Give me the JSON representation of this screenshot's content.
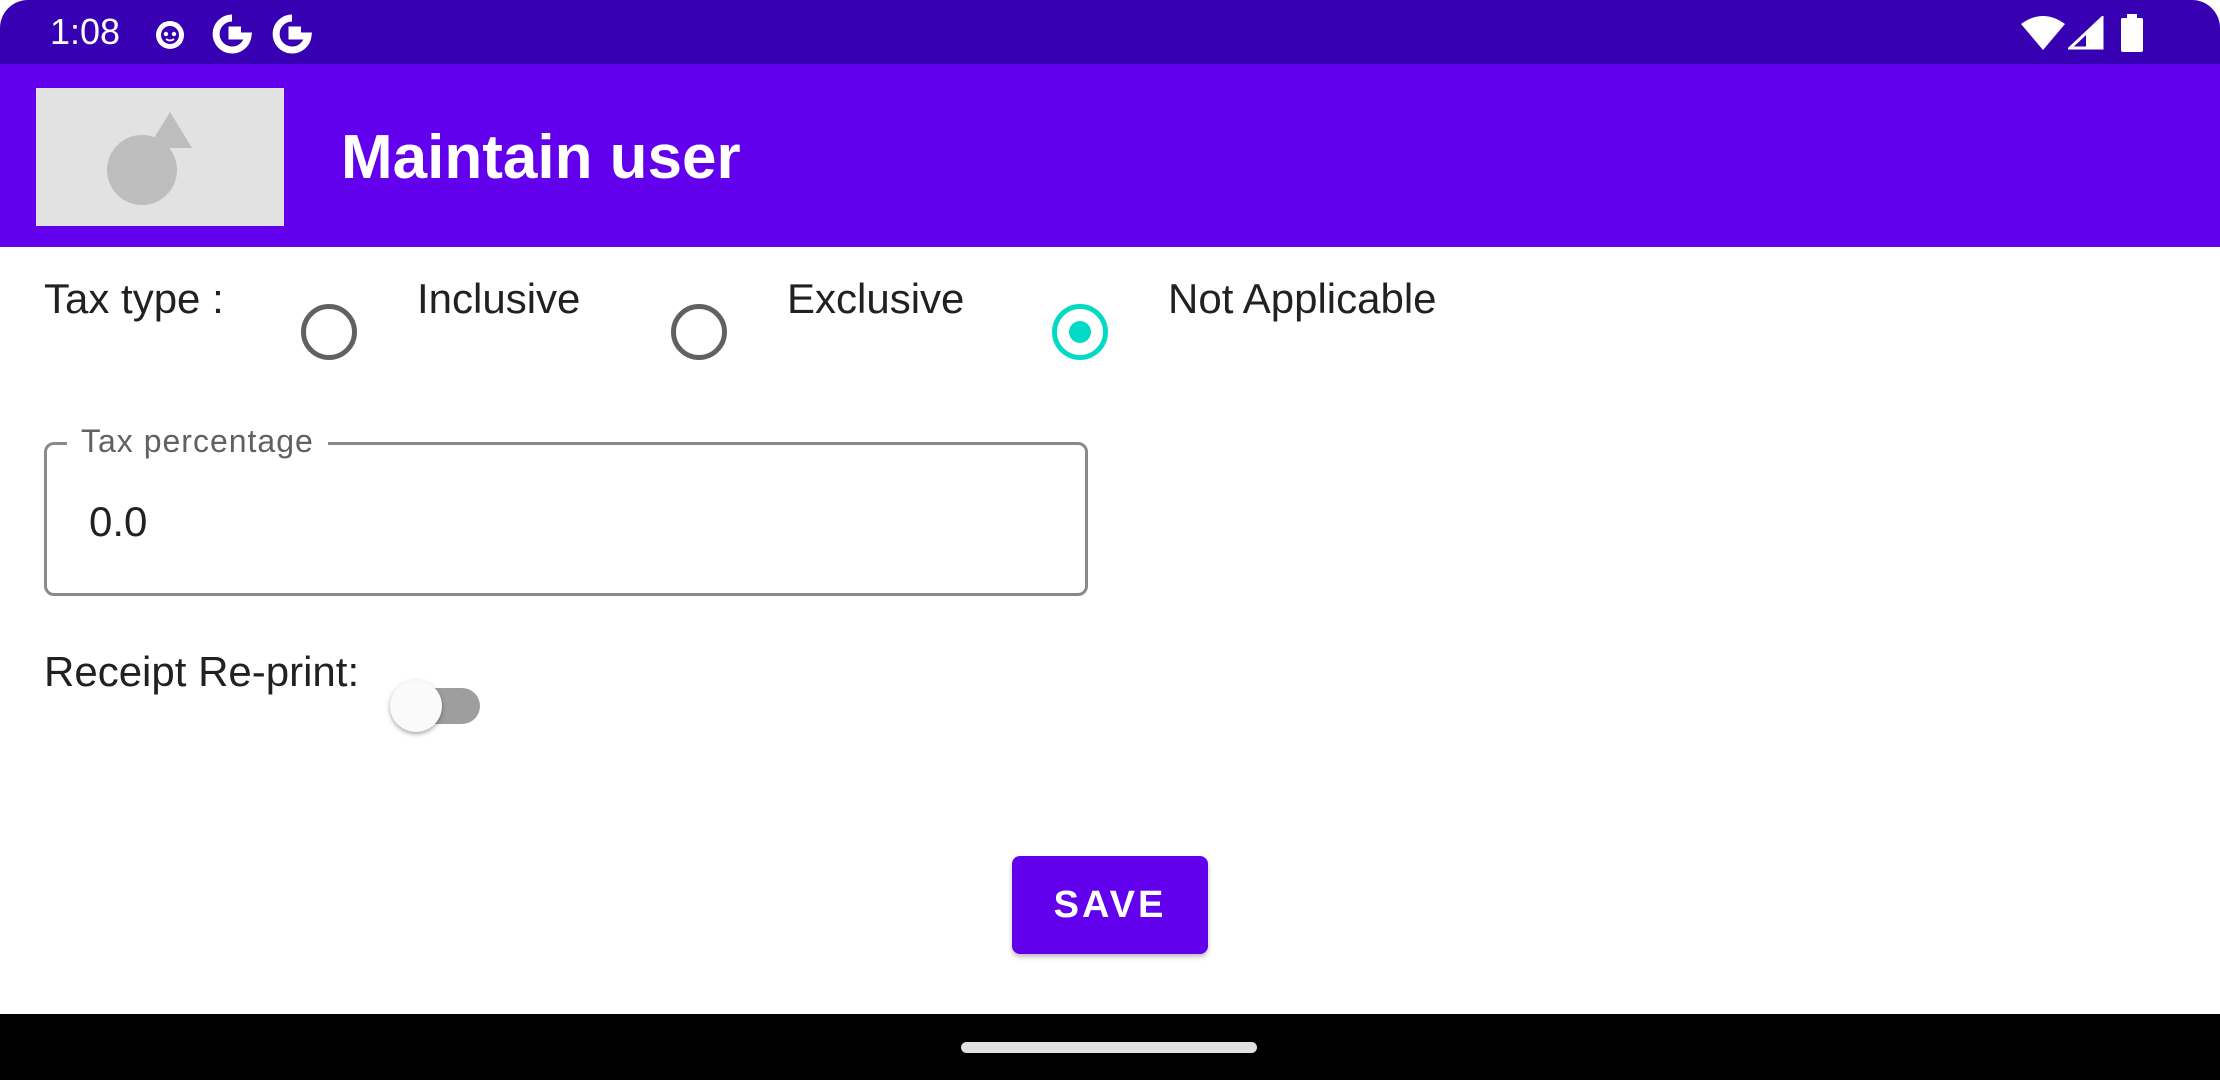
{
  "status_bar": {
    "time": "1:08",
    "icons_left": [
      "android-face-icon",
      "google-icon",
      "google-icon"
    ],
    "icons_right": [
      "wifi-icon",
      "cellular-signal-icon",
      "battery-icon"
    ]
  },
  "app_bar": {
    "title": "Maintain user",
    "logo_icon": "image-placeholder-icon",
    "color": "#6200ee"
  },
  "tax_type": {
    "label": "Tax type :",
    "options": [
      {
        "label": "Inclusive",
        "checked": false
      },
      {
        "label": "Exclusive",
        "checked": false
      },
      {
        "label": "Not Applicable",
        "checked": true
      }
    ],
    "accent_color": "#03dac5"
  },
  "tax_percentage": {
    "label": "Tax percentage",
    "value": "0.0"
  },
  "receipt_reprint": {
    "label": "Receipt Re-print:",
    "enabled": false
  },
  "save_button": {
    "label": "SAVE"
  },
  "colors": {
    "status_bar": "#3700b3",
    "primary": "#6200ee",
    "radio_selected": "#03dac5"
  }
}
